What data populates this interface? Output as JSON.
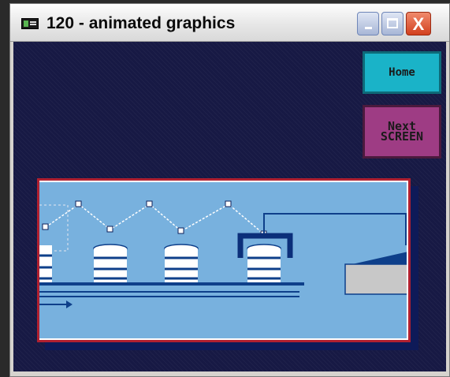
{
  "window": {
    "title": "120 - animated graphics",
    "icon": "app-window-icon",
    "controls": {
      "minimize_icon": "minimize-icon",
      "maximize_icon": "maximize-icon",
      "close_icon": "close-icon",
      "close_glyph": "X"
    }
  },
  "nav": {
    "home_label": "Home",
    "next_label_line1": "Next",
    "next_label_line2": "SCREEN"
  },
  "colors": {
    "background": "#171944",
    "home_button": "#1ab3c8",
    "next_button": "#9e3c84",
    "scene_background": "#78b1de",
    "scene_border": "#b02030"
  }
}
